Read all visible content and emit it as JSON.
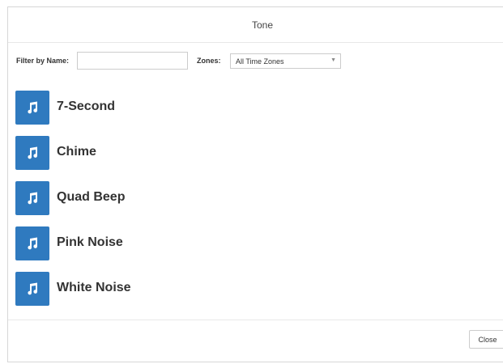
{
  "dialog": {
    "title": "Tone"
  },
  "filters": {
    "name_label": "Filter by Name:",
    "name_value": "",
    "name_placeholder": "",
    "zones_label": "Zones:",
    "zones_selected": "All Time Zones"
  },
  "tones": [
    {
      "label": "7-Second",
      "icon": "music-note-icon"
    },
    {
      "label": "Chime",
      "icon": "music-note-icon"
    },
    {
      "label": "Quad Beep",
      "icon": "music-note-icon"
    },
    {
      "label": "Pink Noise",
      "icon": "music-note-icon"
    },
    {
      "label": "White Noise",
      "icon": "music-note-icon"
    }
  ],
  "footer": {
    "close_label": "Close"
  },
  "colors": {
    "icon_tile": "#2f7abf",
    "text": "#333333"
  }
}
